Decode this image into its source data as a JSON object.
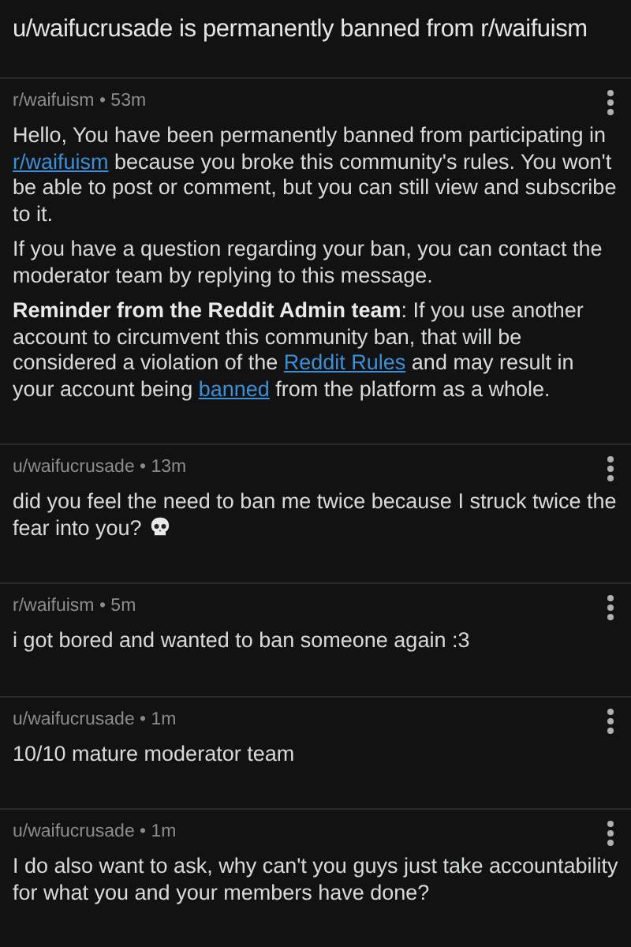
{
  "title": "u/waifucrusade is permanently banned from r/waifuism",
  "messages": [
    {
      "meta": "r/waifuism • 53m",
      "paragraphs": [
        [
          {
            "kind": "text",
            "text": "Hello, You have been permanently banned from participating in "
          },
          {
            "kind": "link",
            "text": "r/waifuism"
          },
          {
            "kind": "text",
            "text": " because you broke this community's rules. You won't be able to post or comment, but you can still view and subscribe to it."
          }
        ],
        [
          {
            "kind": "text",
            "text": "If you have a question regarding your ban, you can contact the moderator team by replying to this message."
          }
        ],
        [
          {
            "kind": "bold",
            "text": "Reminder from the Reddit Admin team"
          },
          {
            "kind": "text",
            "text": ": If you use another account to circumvent this community ban, that will be considered a violation of the "
          },
          {
            "kind": "link",
            "text": "Reddit Rules"
          },
          {
            "kind": "text",
            "text": " and may result in your account being "
          },
          {
            "kind": "link",
            "text": "banned"
          },
          {
            "kind": "text",
            "text": " from the platform as a whole."
          }
        ]
      ]
    },
    {
      "meta": "u/waifucrusade • 13m",
      "paragraphs": [
        [
          {
            "kind": "text",
            "text": "did you feel the need to ban me twice because I struck twice the fear into you? "
          },
          {
            "kind": "skull"
          }
        ]
      ]
    },
    {
      "meta": "r/waifuism • 5m",
      "paragraphs": [
        [
          {
            "kind": "text",
            "text": "i got bored and wanted to ban someone again :3"
          }
        ]
      ]
    },
    {
      "meta": "u/waifucrusade • 1m",
      "paragraphs": [
        [
          {
            "kind": "text",
            "text": "10/10 mature moderator team"
          }
        ]
      ]
    },
    {
      "meta": "u/waifucrusade • 1m",
      "paragraphs": [
        [
          {
            "kind": "text",
            "text": "I do also want to ask, why can't you guys just take accountability for what you and your members have done?"
          }
        ]
      ]
    }
  ]
}
